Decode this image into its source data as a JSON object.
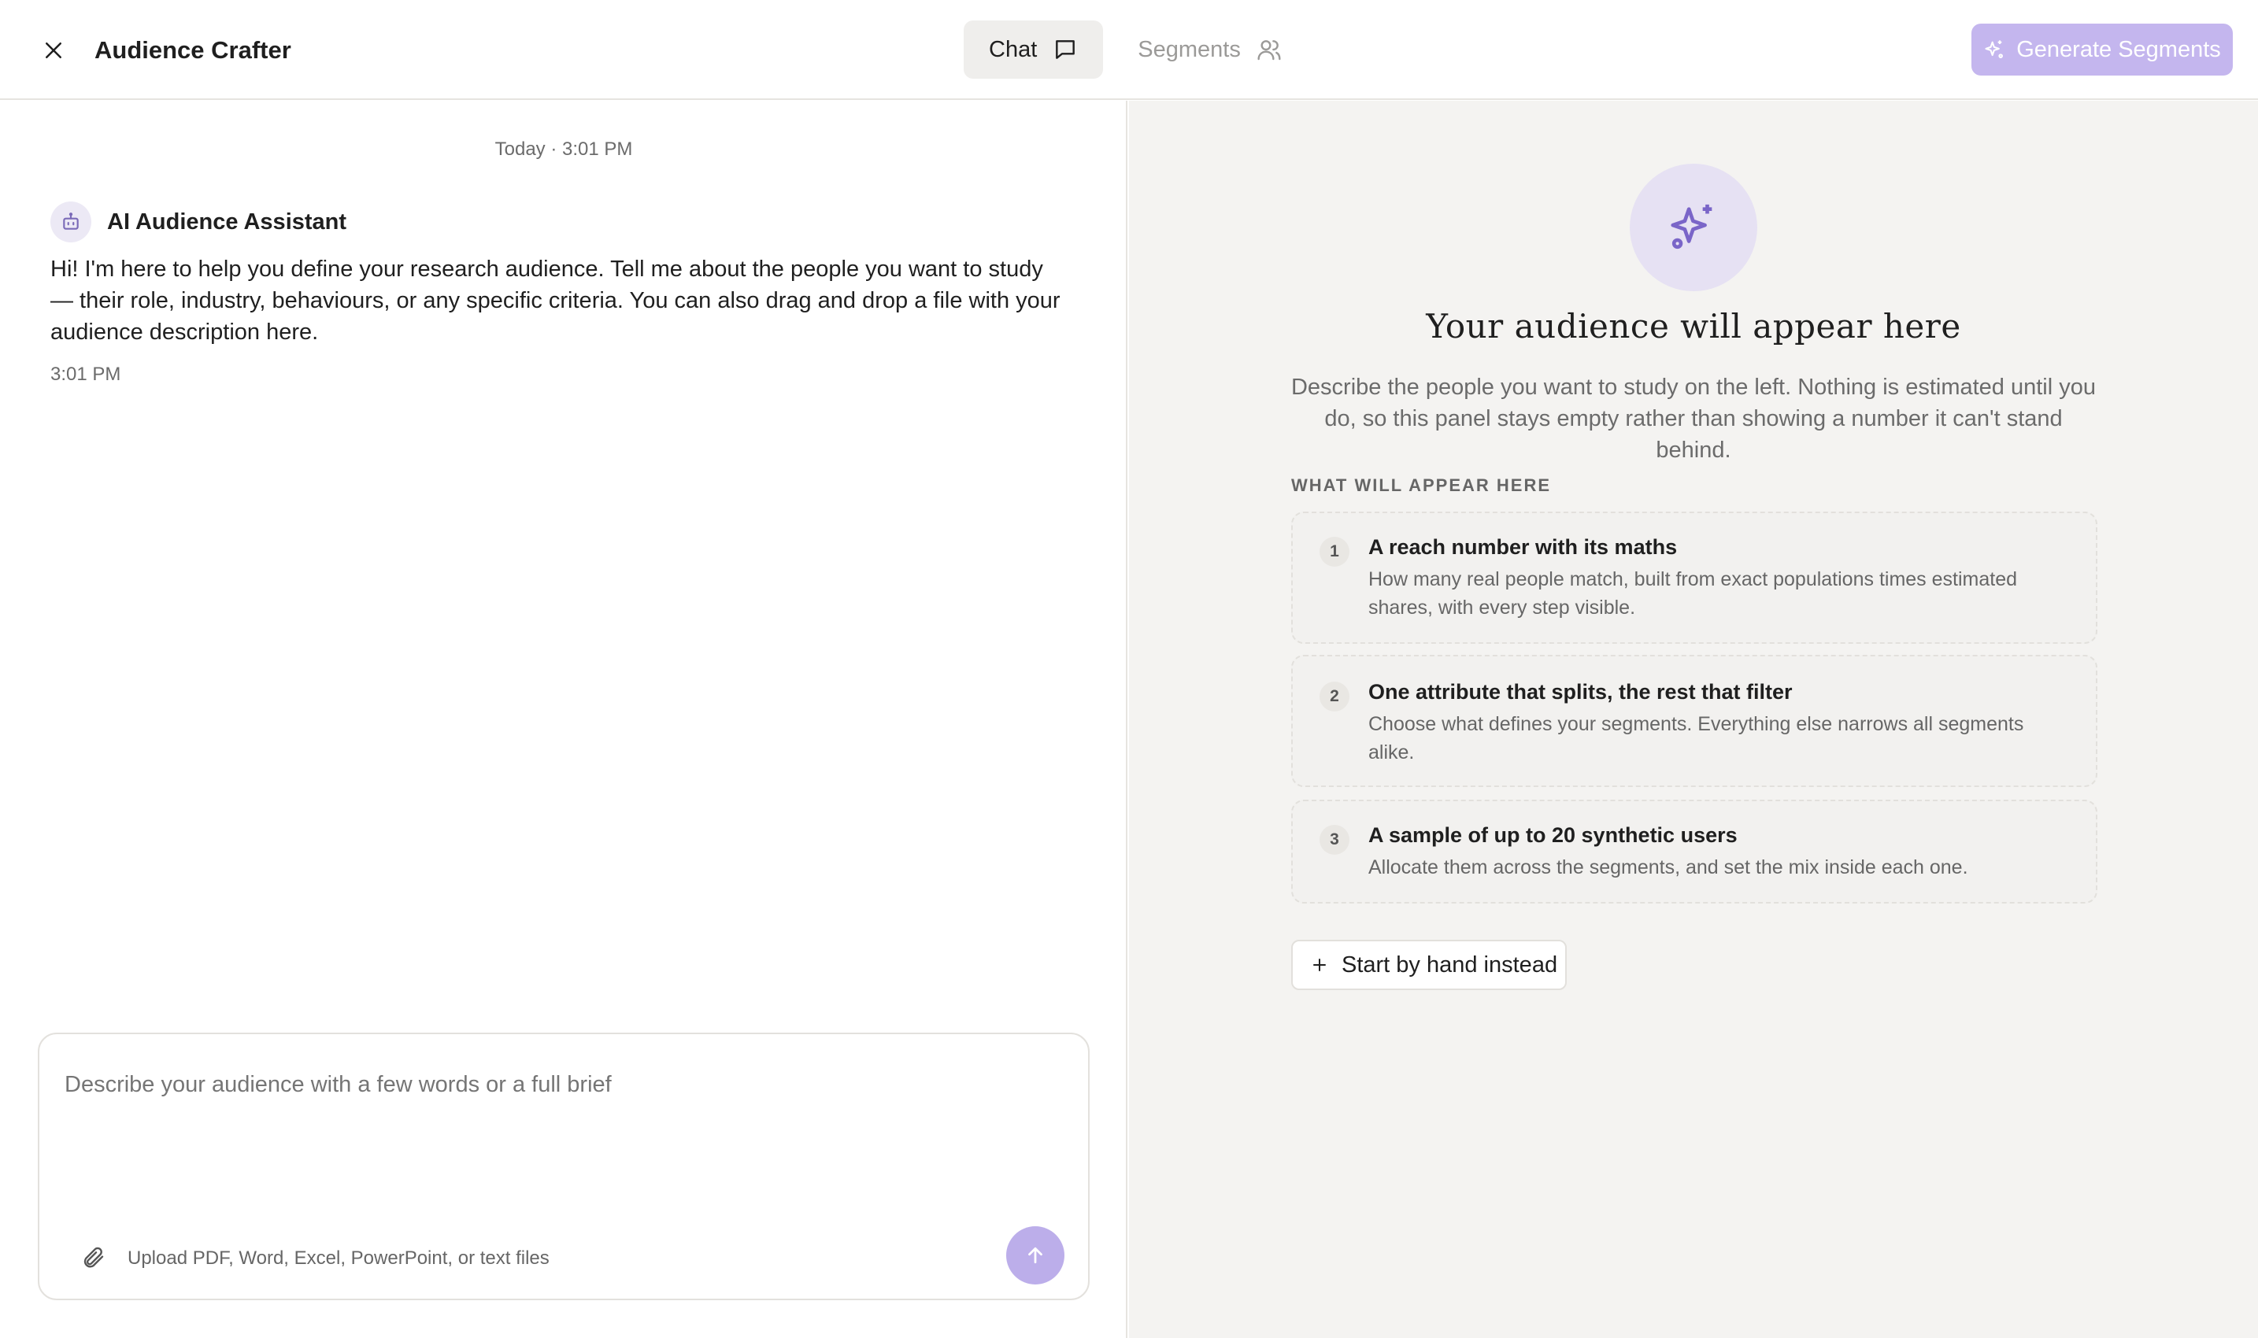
{
  "header": {
    "title": "Audience Crafter",
    "tabs": [
      {
        "label": "Chat",
        "active": true,
        "icon": "message-square-icon"
      },
      {
        "label": "Segments",
        "active": false,
        "icon": "users-icon"
      }
    ],
    "generate_label": "Generate Segments",
    "accent": "#c4b6ee"
  },
  "chat": {
    "date_separator": "Today · 3:01 PM",
    "assistant_name": "AI Audience Assistant",
    "message": "Hi! I'm here to help you define your research audience. Tell me about the people you want to study — their role, industry, behaviours, or any specific criteria. You can also drag and drop a file with your audience description here.",
    "message_time": "3:01 PM",
    "composer": {
      "placeholder": "Describe your audience with a few words or a full brief",
      "upload_hint": "Upload PDF, Word, Excel, PowerPoint, or text files"
    }
  },
  "panel": {
    "title": "Your audience will appear here",
    "description": "Describe the people you want to study on the left. Nothing is estimated until you do, so this panel stays empty rather than showing a number it can't stand behind.",
    "section_label": "WHAT WILL APPEAR HERE",
    "cards": [
      {
        "num": "1",
        "title": "A reach number with its maths",
        "desc": "How many real people match, built from exact populations times estimated shares, with every step visible."
      },
      {
        "num": "2",
        "title": "One attribute that splits, the rest that filter",
        "desc": "Choose what defines your segments. Everything else narrows all segments alike."
      },
      {
        "num": "3",
        "title": "A sample of up to 20 synthetic users",
        "desc": "Allocate them across the segments, and set the mix inside each one."
      }
    ],
    "hand_button": "Start by hand instead"
  }
}
